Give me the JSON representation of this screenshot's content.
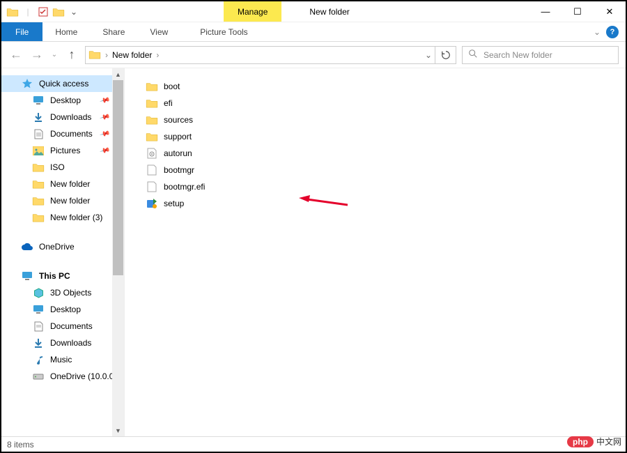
{
  "window": {
    "title": "New folder",
    "context_tab": "Manage",
    "tools_tab": "Picture Tools"
  },
  "ribbon": {
    "file": "File",
    "home": "Home",
    "share": "Share",
    "view": "View"
  },
  "breadcrumb": {
    "current": "New folder"
  },
  "search": {
    "placeholder": "Search New folder"
  },
  "nav": {
    "quick_access": "Quick access",
    "desktop": "Desktop",
    "downloads": "Downloads",
    "documents": "Documents",
    "pictures": "Pictures",
    "iso": "ISO",
    "newfolder": "New folder",
    "newfolder2": "New folder",
    "newfolder3": "New folder (3)",
    "onedrive": "OneDrive",
    "thispc": "This PC",
    "3dobjects": "3D Objects",
    "desktop2": "Desktop",
    "documents2": "Documents",
    "downloads2": "Downloads",
    "music": "Music",
    "onedrive_net": "OneDrive (10.0.0"
  },
  "files": [
    {
      "name": "boot",
      "type": "folder"
    },
    {
      "name": "efi",
      "type": "folder"
    },
    {
      "name": "sources",
      "type": "folder"
    },
    {
      "name": "support",
      "type": "folder"
    },
    {
      "name": "autorun",
      "type": "inf"
    },
    {
      "name": "bootmgr",
      "type": "file"
    },
    {
      "name": "bootmgr.efi",
      "type": "file"
    },
    {
      "name": "setup",
      "type": "exe"
    }
  ],
  "status": {
    "items": "8 items"
  },
  "watermark": {
    "brand": "php",
    "text": "中文网"
  }
}
